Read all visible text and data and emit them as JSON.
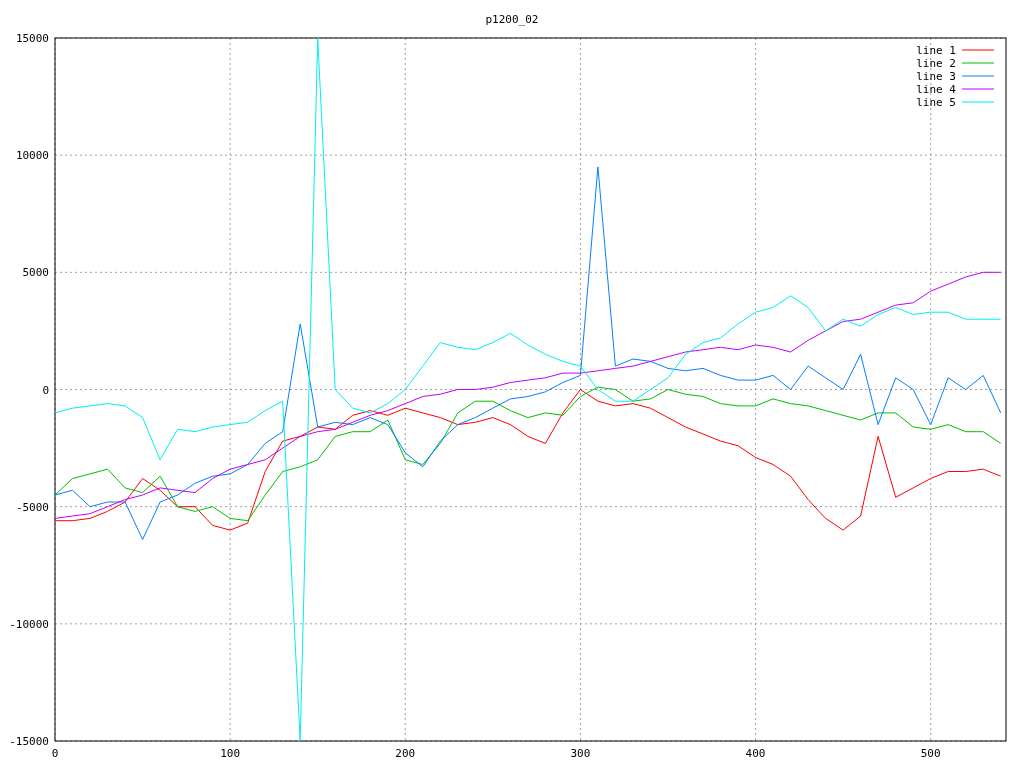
{
  "chart_data": {
    "type": "line",
    "title": "p1200_02",
    "xlim": [
      0,
      543
    ],
    "ylim": [
      -15000,
      15000
    ],
    "grid": true,
    "legend": true,
    "xticks": [
      0,
      100,
      200,
      300,
      400,
      500
    ],
    "yticks": [
      -15000,
      -10000,
      -5000,
      0,
      5000,
      10000,
      15000
    ],
    "x": [
      0,
      10,
      20,
      30,
      40,
      50,
      60,
      70,
      80,
      90,
      100,
      110,
      120,
      130,
      140,
      150,
      160,
      170,
      180,
      190,
      200,
      210,
      220,
      230,
      240,
      250,
      260,
      270,
      280,
      290,
      300,
      310,
      320,
      330,
      340,
      350,
      360,
      370,
      380,
      390,
      400,
      410,
      420,
      430,
      440,
      450,
      460,
      470,
      480,
      490,
      500,
      510,
      520,
      530,
      540
    ],
    "series": [
      {
        "name": "line 1",
        "color": "#ff0000",
        "values": [
          -5600,
          -5600,
          -5500,
          -5200,
          -4800,
          -3800,
          -4300,
          -5000,
          -5000,
          -5800,
          -6000,
          -5700,
          -3500,
          -2200,
          -2000,
          -1600,
          -1700,
          -1100,
          -900,
          -1100,
          -800,
          -1000,
          -1200,
          -1500,
          -1400,
          -1200,
          -1500,
          -2000,
          -2300,
          -1000,
          0,
          -500,
          -700,
          -600,
          -800,
          -1200,
          -1600,
          -1900,
          -2200,
          -2400,
          -2900,
          -3200,
          -3700,
          -4700,
          -5500,
          -6000,
          -5400,
          -2000,
          -4600,
          -4200,
          -3800,
          -3500,
          -3500,
          -3400,
          -3700
        ]
      },
      {
        "name": "line 2",
        "color": "#00c000",
        "values": [
          -4500,
          -3800,
          -3600,
          -3400,
          -4200,
          -4400,
          -3700,
          -5000,
          -5200,
          -5000,
          -5500,
          -5600,
          -4500,
          -3500,
          -3300,
          -3000,
          -2000,
          -1800,
          -1800,
          -1300,
          -3000,
          -3200,
          -2300,
          -1000,
          -500,
          -500,
          -900,
          -1200,
          -1000,
          -1100,
          -300,
          100,
          0,
          -500,
          -400,
          0,
          -200,
          -300,
          -600,
          -700,
          -700,
          -400,
          -600,
          -700,
          -900,
          -1100,
          -1300,
          -1000,
          -1000,
          -1600,
          -1700,
          -1500,
          -1800,
          -1800,
          -2300
        ]
      },
      {
        "name": "line 3",
        "color": "#0080ff",
        "values": [
          -4500,
          -4300,
          -5000,
          -4800,
          -4800,
          -6400,
          -4800,
          -4500,
          -4000,
          -3700,
          -3600,
          -3200,
          -2300,
          -1800,
          2800,
          -1600,
          -1400,
          -1500,
          -1200,
          -1500,
          -2700,
          -3300,
          -2200,
          -1500,
          -1200,
          -800,
          -400,
          -300,
          -100,
          300,
          600,
          9500,
          1000,
          1300,
          1200,
          900,
          800,
          900,
          600,
          400,
          400,
          600,
          0,
          1000,
          500,
          0,
          1500,
          -1500,
          500,
          0,
          -1500,
          500,
          0,
          600,
          -1000
        ]
      },
      {
        "name": "line 4",
        "color": "#c000ff",
        "values": [
          -5500,
          -5400,
          -5300,
          -5000,
          -4700,
          -4500,
          -4200,
          -4300,
          -4400,
          -3800,
          -3400,
          -3200,
          -3000,
          -2500,
          -2000,
          -1800,
          -1700,
          -1400,
          -1100,
          -900,
          -600,
          -300,
          -200,
          0,
          0,
          100,
          300,
          400,
          500,
          700,
          700,
          800,
          900,
          1000,
          1200,
          1400,
          1600,
          1700,
          1800,
          1700,
          1900,
          1800,
          1600,
          2100,
          2500,
          2900,
          3000,
          3300,
          3600,
          3700,
          4200,
          4500,
          4800,
          5000,
          5000
        ]
      },
      {
        "name": "line 5",
        "color": "#00eeee",
        "values": [
          -1000,
          -800,
          -700,
          -600,
          -700,
          -1200,
          -3000,
          -1700,
          -1800,
          -1600,
          -1500,
          -1400,
          -900,
          -500,
          -15000,
          15000,
          0,
          -800,
          -1000,
          -600,
          0,
          1000,
          2000,
          1800,
          1700,
          2000,
          2400,
          1900,
          1500,
          1200,
          1000,
          0,
          -500,
          -500,
          0,
          500,
          1500,
          2000,
          2200,
          2800,
          3300,
          3500,
          4000,
          3500,
          2500,
          3000,
          2700,
          3200,
          3500,
          3200,
          3300,
          3300,
          3000,
          3000,
          3000
        ]
      }
    ]
  }
}
